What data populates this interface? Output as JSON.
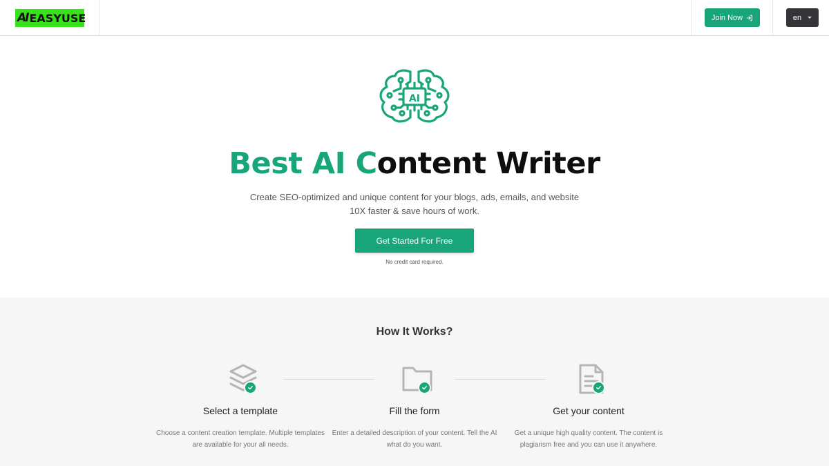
{
  "header": {
    "logo_mark": "AI",
    "logo_text": "EASYUSE",
    "join_label": "Join Now",
    "join_icon": "sign-in-icon",
    "lang_label": "en",
    "lang_icon": "caret-down-icon"
  },
  "hero": {
    "icon": "ai-brain-icon",
    "icon_label": "AI",
    "title_accent": "Best AI C",
    "title_rest": "ontent Writer",
    "subtitle": "Create SEO-optimized and unique content for your blogs, ads, emails, and website 10X faster & save hours of work.",
    "cta_label": "Get Started For Free",
    "cta_note": "No credit card required."
  },
  "how": {
    "title": "How It Works?",
    "steps": [
      {
        "icon": "layers-icon",
        "title": "Select a template",
        "description": "Choose a content creation template. Multiple templates are available for your all needs."
      },
      {
        "icon": "folder-icon",
        "title": "Fill the form",
        "description": "Enter a detailed description of your content. Tell the AI what do you want."
      },
      {
        "icon": "document-icon",
        "title": "Get your content",
        "description": "Get a unique high quality content. The content is plagiarism free and you can use it anywhere."
      }
    ],
    "check_icon": "check-circle-icon"
  },
  "colors": {
    "accent": "#18a57a",
    "logo_bg": "#38e21b",
    "lang_bg": "#333538",
    "section_bg": "#f6f6f6"
  }
}
